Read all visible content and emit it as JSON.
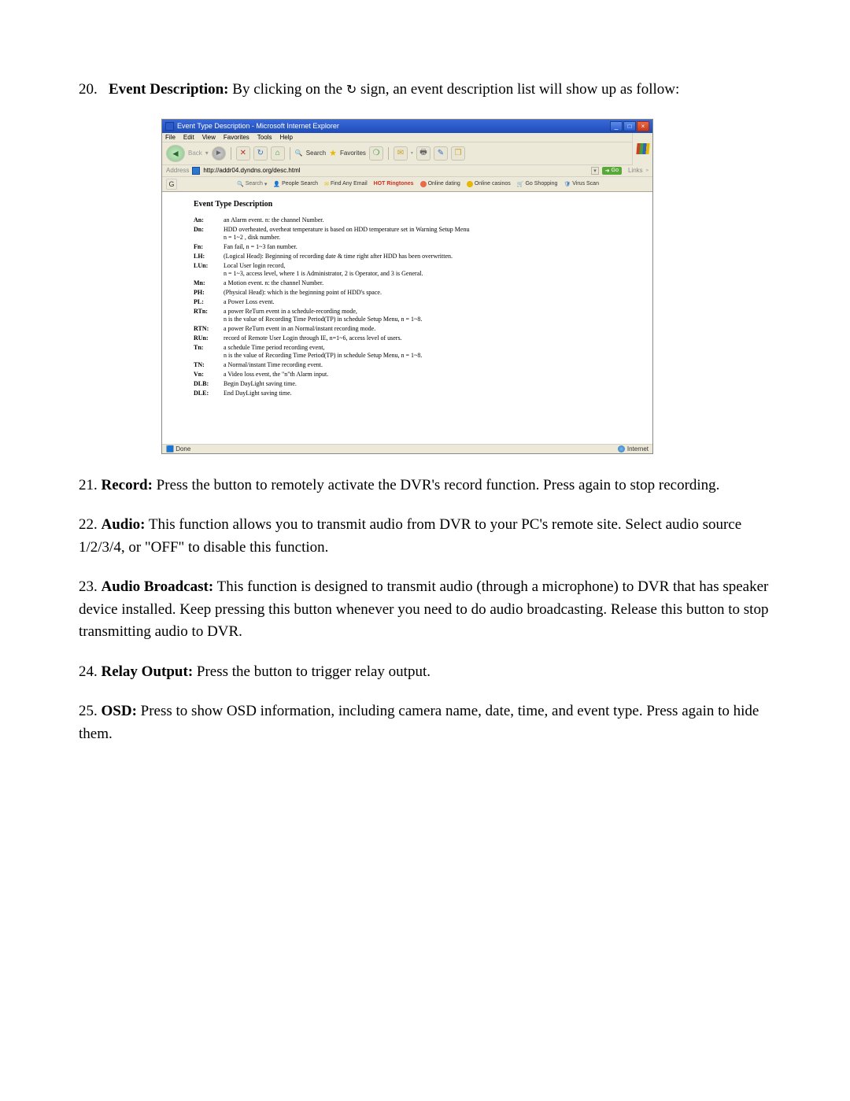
{
  "sections": {
    "s20": {
      "num": "20.",
      "title": "Event Description:",
      "body_a": " By clicking on the ",
      "body_b": " sign, an event description list will show up as follow:"
    },
    "s21": {
      "num": "21.",
      "title": "Record:",
      "body": " Press the button to remotely activate the DVR's record function. Press again to stop recording."
    },
    "s22": {
      "num": "22.",
      "title": "Audio:",
      "body": " This function allows you to transmit audio from DVR to your PC's remote site.  Select audio source 1/2/3/4, or \"OFF\" to disable this function."
    },
    "s23": {
      "num": "23.",
      "title": "Audio Broadcast:",
      "body": " This function is designed to transmit audio (through a microphone) to DVR that has speaker device installed. Keep pressing this button whenever you need to do audio broadcasting. Release this button to stop transmitting audio to DVR."
    },
    "s24": {
      "num": "24.",
      "title": "Relay Output:",
      "body": " Press the button to trigger relay output."
    },
    "s25": {
      "num": "25.",
      "title": "OSD:",
      "body": " Press to show OSD information, including camera name, date, time, and event type. Press again to hide them."
    }
  },
  "ie": {
    "title": "Event Type Description - Microsoft Internet Explorer",
    "menu": {
      "file": "File",
      "edit": "Edit",
      "view": "View",
      "favorites": "Favorites",
      "tools": "Tools",
      "help": "Help"
    },
    "toolbar": {
      "back": "Back",
      "search": "Search",
      "favorites": "Favorites"
    },
    "addr": {
      "label": "Address",
      "url": "http://addr04.dyndns.org/desc.html",
      "go": "Go",
      "links": "Links"
    },
    "searchbar": {
      "search": "Search",
      "people": "People Search",
      "email": "Find Any Email",
      "ring": "HOT Ringtones",
      "dating": "Online dating",
      "casinos": "Online casinos",
      "shop": "Go Shopping",
      "virus": "Virus Scan"
    },
    "content_title": "Event Type Description",
    "events": [
      {
        "code": "An:",
        "desc": "an Alarm event. n: the channel Number."
      },
      {
        "code": "Dn:",
        "desc": "HDD overheated, overheat temperature is based on HDD temperature set in Warning Setup Menu\nn = 1~2 , disk number."
      },
      {
        "code": "Fn:",
        "desc": "Fan fail, n = 1~3 fan number."
      },
      {
        "code": "LH:",
        "desc": "(Logical Head): Beginning of recording date & time right after HDD has been overwritten."
      },
      {
        "code": "LUn:",
        "desc": "Local User login record,\nn = 1~3, access level, where 1 is Administrator, 2 is Operator, and 3 is General."
      },
      {
        "code": "Mn:",
        "desc": "a Motion event. n: the channel Number."
      },
      {
        "code": "PH:",
        "desc": "(Physical Head): which is the beginning point of HDD's space."
      },
      {
        "code": "PL:",
        "desc": "a Power Loss event."
      },
      {
        "code": "RTn:",
        "desc": "a power ReTurn event in a schedule-recording mode,\nn is the value of Recording Time Period(TP) in schedule Setup Menu, n = 1~8."
      },
      {
        "code": "RTN:",
        "desc": "a power ReTurn event in an Normal/instant recording mode."
      },
      {
        "code": "RUn:",
        "desc": "record of Remote User Login through IE, n=1~6, access level of users."
      },
      {
        "code": "Tn:",
        "desc": "a schedule Time period recording event,\nn is the value of Recording Time Period(TP) in schedule Setup Menu, n = 1~8."
      },
      {
        "code": "TN:",
        "desc": "a Normal/instant Time recording event."
      },
      {
        "code": "Vn:",
        "desc": "a Video loss event, the \"n\"th Alarm input."
      },
      {
        "code": "DLB:",
        "desc": "Begin DayLight saving time."
      },
      {
        "code": "DLE:",
        "desc": "End DayLight saving time."
      }
    ],
    "status": {
      "done": "Done",
      "zone": "Internet"
    }
  }
}
